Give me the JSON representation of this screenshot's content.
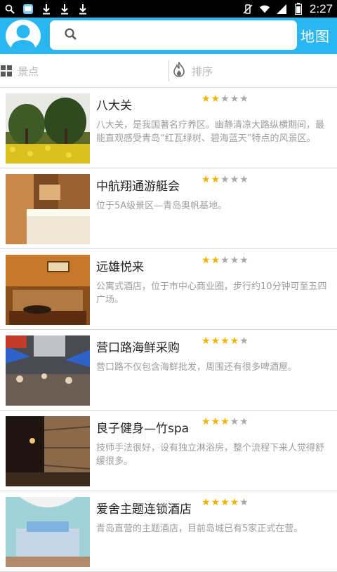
{
  "status_bar": {
    "time": "2:27",
    "left_icons": [
      "search-icon",
      "app-icon",
      "download-icon",
      "download-icon",
      "download-icon"
    ],
    "right_icons": [
      "vibrate-icon",
      "wifi-icon",
      "signal-icon",
      "battery-icon"
    ]
  },
  "header": {
    "search": {
      "value": "",
      "placeholder": ""
    },
    "map_label": "地图",
    "accent_color": "#2ab6f0"
  },
  "tabs": {
    "spots_label": "景点",
    "sort_label": "排序"
  },
  "items": [
    {
      "title": "八大关",
      "rating": 2,
      "desc": "八大关，是我国著名疗养区。幽静清凉大路纵横期间，最能直观感受青岛“红瓦绿树、碧海蓝天”特点的风景区。",
      "image": "park-photo"
    },
    {
      "title": "中航翔通游艇会",
      "rating": 2,
      "desc": "位于5A级景区—青岛奥帆基地。",
      "image": "hotel-room-photo"
    },
    {
      "title": "远雄悦来",
      "rating": 2,
      "desc": "公寓式酒店，位于市中心商业圈，步行约10分钟可至五四广场。",
      "image": "lounge-photo"
    },
    {
      "title": "营口路海鲜采购",
      "rating": 4,
      "desc": "营口路不仅包含海鲜批发，周围还有很多啤酒屋。",
      "image": "street-market-photo"
    },
    {
      "title": "良子健身—竹spa",
      "rating": 3,
      "desc": "技师手法很好，设有独立淋浴房，整个流程下来人觉得舒缓很多。",
      "image": "spa-corridor-photo"
    },
    {
      "title": "爱舍主题连锁酒店",
      "rating": 4,
      "desc": "青岛直营的主题酒店，目前岛城已有5家正式在营。",
      "image": "theme-room-photo"
    }
  ]
}
